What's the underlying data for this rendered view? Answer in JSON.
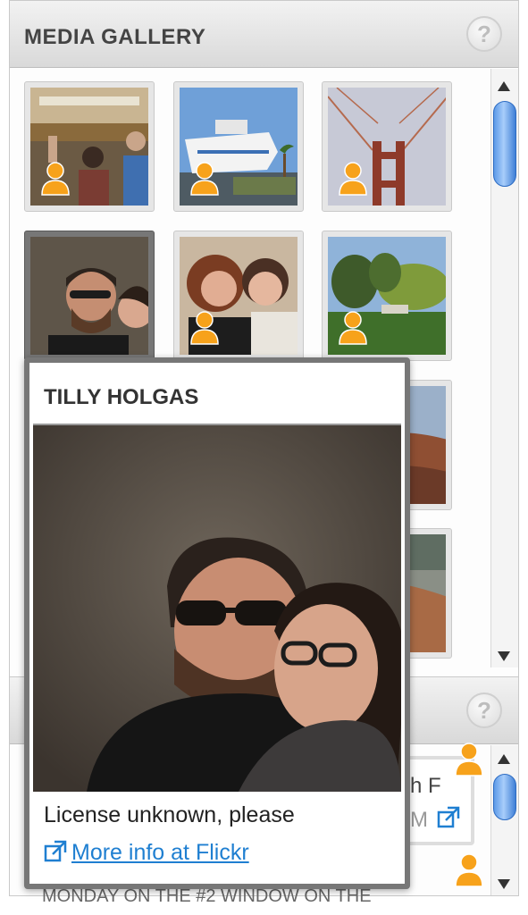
{
  "gallery": {
    "title": "MEDIA GALLERY",
    "help_label": "?"
  },
  "second_panel": {
    "help_label": "?",
    "item1_partial_text": "h F",
    "item1_partial_sub": "M",
    "bottom_partial_text": "MONDAY ON THE #2 WINDOW ON THE"
  },
  "popup": {
    "title": "TILLY HOLGAS",
    "license": "License unknown, please",
    "link_label": "More info at Flickr"
  },
  "icons": {
    "user": "user-badge-icon",
    "help": "help-icon",
    "external": "external-link-icon"
  },
  "colors": {
    "accent_link": "#1f7fd1",
    "badge_orange": "#f7a21b",
    "scroll_thumb": "#5d9ae8"
  }
}
